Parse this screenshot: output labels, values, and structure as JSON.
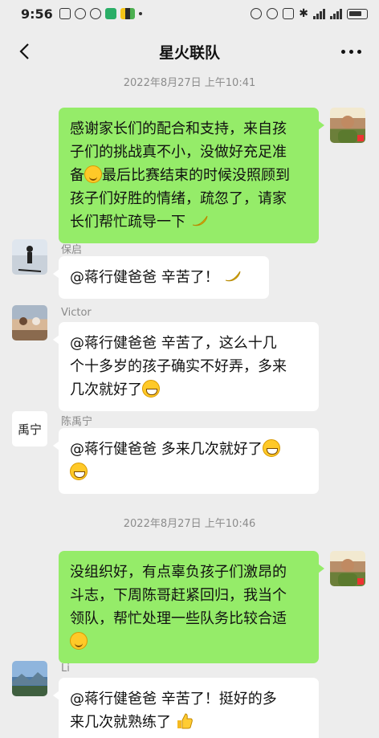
{
  "status": {
    "time": "9:56"
  },
  "nav": {
    "title": "星火联队"
  },
  "messages": [
    {
      "type": "time",
      "text": "2022年8月27日 上午10:41"
    },
    {
      "type": "me",
      "lines": [
        "感谢家长们的配合和支持，来自孩",
        "子们的挑战真不小，没做好充足准",
        "备",
        "最后比赛结束的时候没照顾到",
        "孩子们好胜的情绪，疏忽了，请家",
        "长们帮忙疏导一下"
      ]
    },
    {
      "type": "other",
      "sender": "保启",
      "text": "@蒋行健爸爸  辛苦了！"
    },
    {
      "type": "other",
      "sender": "Victor",
      "lines": [
        "@蒋行健爸爸  辛苦了，这么十几",
        "个十多岁的孩子确实不好弄，多来",
        "几次就好了"
      ]
    },
    {
      "type": "other",
      "sender": "陈禹宁",
      "text": "@蒋行健爸爸  多来几次就好了"
    },
    {
      "type": "time",
      "text": "2022年8月27日 上午10:46"
    },
    {
      "type": "me",
      "lines": [
        "没组织好，有点辜负孩子们激昂的",
        "斗志，下周陈哥赶紧回归，我当个",
        "领队，帮忙处理一些队务比较合适"
      ]
    },
    {
      "type": "other",
      "sender": "Li",
      "lines": [
        "@蒋行健爸爸  辛苦了！挺好的多",
        "来几次就熟练了"
      ]
    }
  ],
  "avatar_text": {
    "chenyuning": "禹宁"
  }
}
